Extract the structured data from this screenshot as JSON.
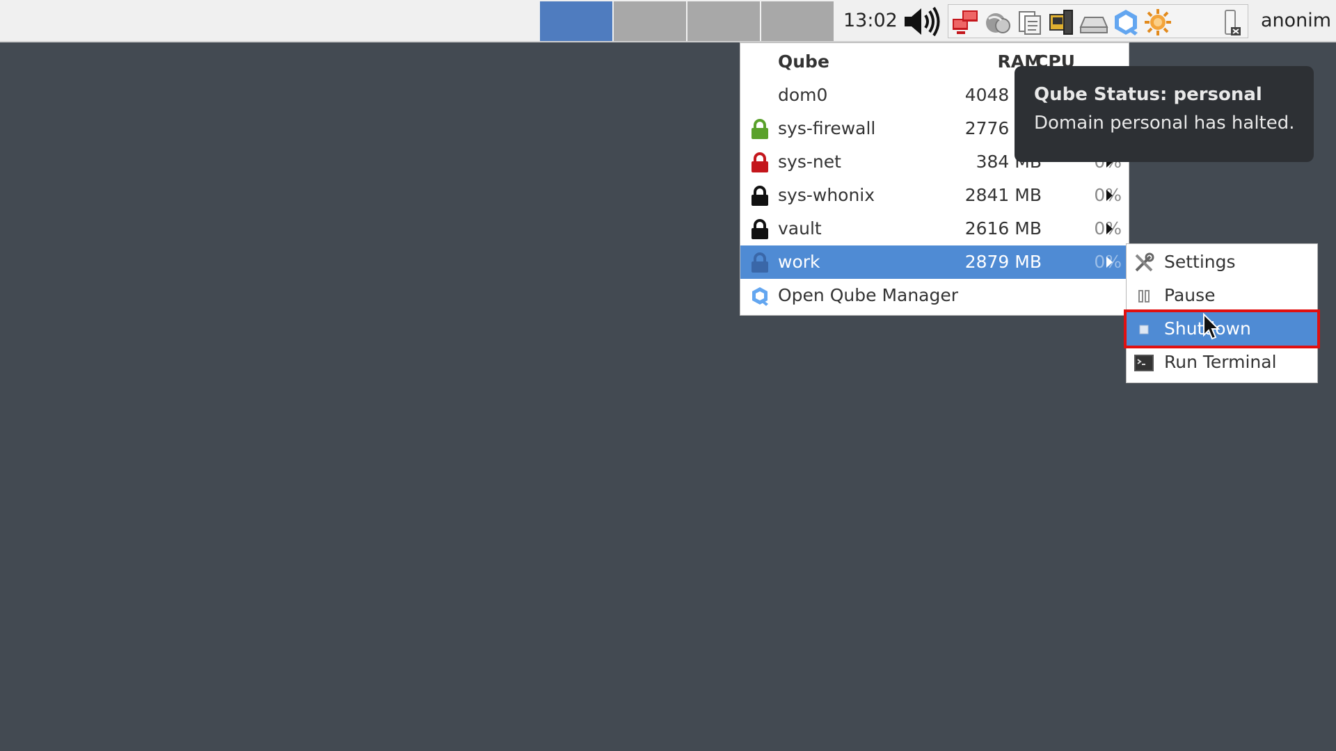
{
  "panel": {
    "workspaces": [
      {
        "name": "workspace-1",
        "active": true
      },
      {
        "name": "workspace-2",
        "active": false
      },
      {
        "name": "workspace-3",
        "active": false
      },
      {
        "name": "workspace-4",
        "active": false
      }
    ],
    "clock": "13:02",
    "tray_icons": [
      "volume-icon",
      "network-disconnected-icon",
      "globe-icon",
      "clipboard-icon",
      "devices-icon",
      "drive-icon",
      "qube-manager-icon",
      "updates-icon",
      "battery-icon"
    ],
    "user": "anonim"
  },
  "menu": {
    "headers": {
      "name": "Qube",
      "ram": "RAM",
      "cpu": "CPU"
    },
    "rows": [
      {
        "name": "dom0",
        "ram": "4048 MB",
        "cpu": "",
        "lock_color": "",
        "has_submenu": false
      },
      {
        "name": "sys-firewall",
        "ram": "2776 MB",
        "cpu": "0%",
        "lock_color": "#5aa12b",
        "has_submenu": true
      },
      {
        "name": "sys-net",
        "ram": "384 MB",
        "cpu": "0%",
        "lock_color": "#c4161c",
        "has_submenu": true
      },
      {
        "name": "sys-whonix",
        "ram": "2841 MB",
        "cpu": "0%",
        "lock_color": "#111111",
        "has_submenu": true
      },
      {
        "name": "vault",
        "ram": "2616 MB",
        "cpu": "0%",
        "lock_color": "#111111",
        "has_submenu": true
      },
      {
        "name": "work",
        "ram": "2879 MB",
        "cpu": "0%",
        "lock_color": "#3a67a8",
        "has_submenu": true,
        "highlighted": true
      }
    ],
    "open_manager": "Open Qube Manager"
  },
  "submenu": {
    "items": [
      {
        "label": "Settings",
        "icon": "settings-icon"
      },
      {
        "label": "Pause",
        "icon": "pause-icon"
      },
      {
        "label": "Shutdown",
        "icon": "shutdown-icon",
        "highlighted": true
      },
      {
        "label": "Run Terminal",
        "icon": "terminal-icon"
      }
    ]
  },
  "tooltip": {
    "title": "Qube Status: personal",
    "body": "Domain personal has halted."
  },
  "colors": {
    "desktop": "#434a52",
    "highlight": "#4f8bd4",
    "annotation": "#e01010"
  }
}
